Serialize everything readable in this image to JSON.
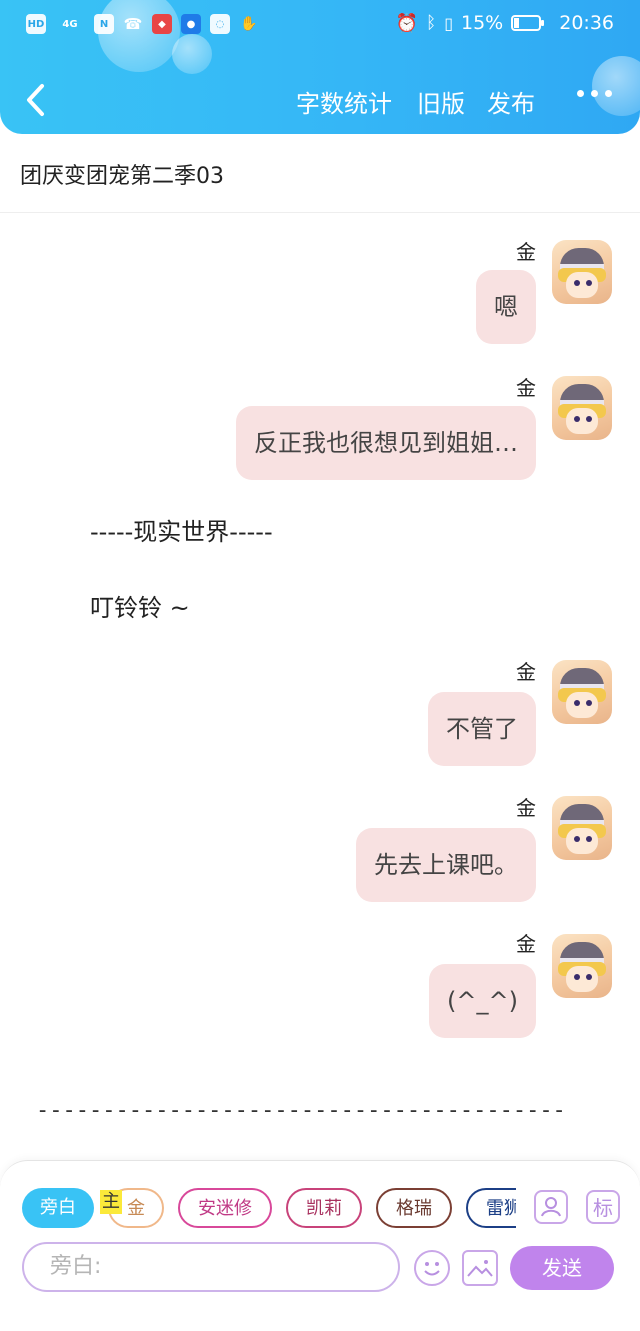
{
  "status_bar": {
    "left_icons": [
      "HD",
      "4G",
      "N",
      "call-icon",
      "app-icon",
      "bulb-icon",
      "chat-icon",
      "hand-icon"
    ],
    "battery": "15%",
    "time": "20:36"
  },
  "toolbar": {
    "word_count": "字数统计",
    "old_version": "旧版",
    "publish": "发布"
  },
  "document": {
    "title": "团厌变团宠第二季03"
  },
  "messages": [
    {
      "speaker": "金",
      "text": "嗯"
    },
    {
      "speaker": "金",
      "text": "反正我也很想见到姐姐…"
    },
    {
      "speaker": "金",
      "text": "不管了"
    },
    {
      "speaker": "金",
      "text": "先去上课吧。"
    },
    {
      "speaker": "金",
      "text": "(^_^)"
    }
  ],
  "narration": [
    "-----现实世界-----",
    "叮铃铃 ~"
  ],
  "divider": "----------------------------------------",
  "characters": {
    "narrator": "旁白",
    "main_marker": "主",
    "jin": "金",
    "amx": "安迷修",
    "kaili": "凯莉",
    "gerui": "格瑞",
    "leishi": "雷狮"
  },
  "icons": {
    "profile": "profile-icon",
    "tag": "标"
  },
  "input": {
    "placeholder": "旁白:",
    "send": "发送"
  },
  "colors": {
    "header": "#39c3f5",
    "bubble": "#f8e1e1",
    "send": "#c084ec"
  }
}
